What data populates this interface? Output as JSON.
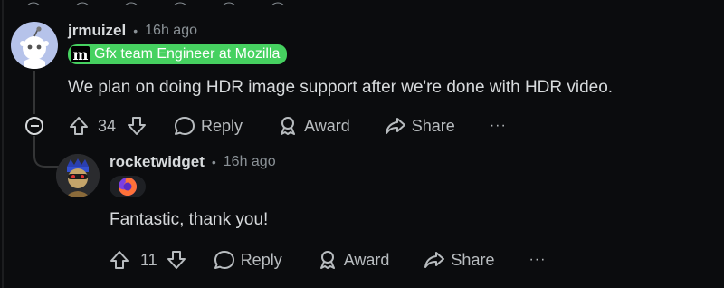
{
  "comment1": {
    "username": "jrmuizel",
    "separator": "•",
    "time": "16h ago",
    "flair": "Gfx team Engineer at Mozilla",
    "flair_logo": "m",
    "body": "We plan on doing HDR image support after we're done with HDR video.",
    "votes": "34",
    "reply_label": "Reply",
    "award_label": "Award",
    "share_label": "Share",
    "more_label": "···"
  },
  "comment2": {
    "username": "rocketwidget",
    "separator": "•",
    "time": "16h ago",
    "badge_icon": "firefox-icon",
    "body": "Fantastic, thank you!",
    "votes": "11",
    "reply_label": "Reply",
    "award_label": "Award",
    "share_label": "Share",
    "more_label": "···"
  },
  "colors": {
    "background": "#0b0c0e",
    "text": "#d7dadc",
    "muted": "#8a9196",
    "flair_bg": "#46d160",
    "avatar1_bg": "#b6c3ea"
  }
}
